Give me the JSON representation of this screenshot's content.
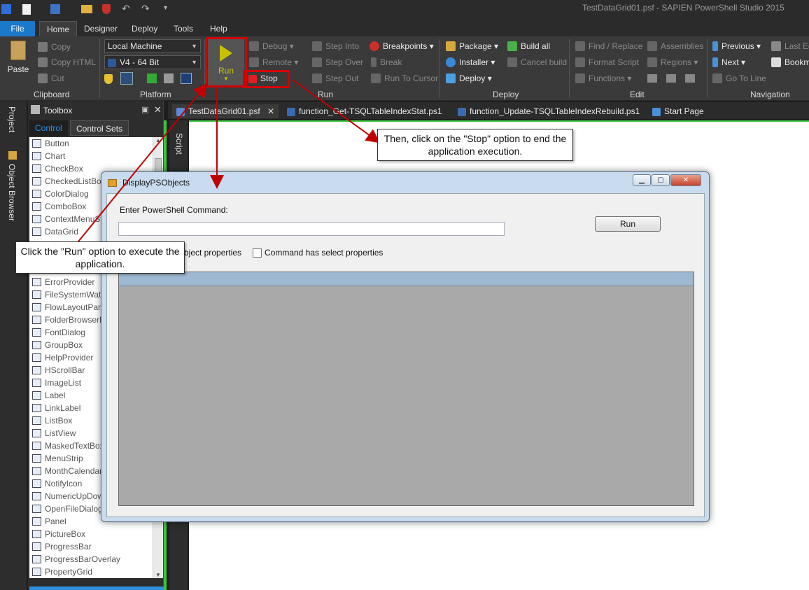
{
  "window_title": "TestDataGrid01.psf - SAPIEN PowerShell Studio 2015",
  "menu": {
    "tabs": [
      "File",
      "Home",
      "Designer",
      "Deploy",
      "Tools",
      "Help"
    ]
  },
  "ribbon": {
    "clipboard": {
      "paste": "Paste",
      "copy": "Copy",
      "copy_html": "Copy HTML",
      "cut": "Cut",
      "label": "Clipboard"
    },
    "platform": {
      "machine": "Local Machine",
      "version": "V4  -  64 Bit",
      "label": "Platform"
    },
    "run": {
      "run": "Run",
      "debug": "Debug",
      "remote": "Remote",
      "stop": "Stop",
      "step_into": "Step Into",
      "step_over": "Step Over",
      "step_out": "Step Out",
      "breakpoints": "Breakpoints",
      "break": "Break",
      "run_to_cursor": "Run To Cursor",
      "label": "Run"
    },
    "deploy": {
      "package": "Package",
      "installer": "Installer",
      "deploy": "Deploy",
      "build_all": "Build all",
      "cancel_build": "Cancel build",
      "label": "Deploy"
    },
    "edit": {
      "find_replace": "Find / Replace",
      "format_script": "Format Script",
      "functions": "Functions",
      "assemblies": "Assemblies",
      "regions": "Regions",
      "label": "Edit"
    },
    "navigation": {
      "previous": "Previous",
      "next": "Next",
      "go_to_line": "Go To Line",
      "last_edit": "Last Ed",
      "bookmark": "Bookma",
      "label": "Navigation"
    }
  },
  "dock": {
    "project": "Project",
    "object_browser": "Object Browser",
    "script": "Script"
  },
  "toolbox": {
    "title": "Toolbox",
    "tab_control": "Control",
    "tab_control_sets": "Control Sets",
    "items": [
      "Button",
      "Chart",
      "CheckBox",
      "CheckedListBox",
      "ColorDialog",
      "ComboBox",
      "ContextMenuStrip",
      "DataGrid",
      "",
      "",
      "",
      "ErrorProvider",
      "FileSystemWatcher",
      "FlowLayoutPanel",
      "FolderBrowserDialog",
      "FontDialog",
      "GroupBox",
      "HelpProvider",
      "HScrollBar",
      "ImageList",
      "Label",
      "LinkLabel",
      "ListBox",
      "ListView",
      "MaskedTextBox",
      "MenuStrip",
      "MonthCalendar",
      "NotifyIcon",
      "NumericUpDown",
      "OpenFileDialog",
      "Panel",
      "PictureBox",
      "ProgressBar",
      "ProgressBarOverlay",
      "PropertyGrid"
    ]
  },
  "doc_tabs": [
    "TestDataGrid01.psf",
    "function_Get-TSQLTableIndexStat.ps1",
    "function_Update-TSQLTableIndexRebuild.ps1",
    "Start Page"
  ],
  "form": {
    "title": "DisplayPSObjects",
    "label_command": "Enter PowerShell Command:",
    "command_value": "",
    "run_button": "Run",
    "checkbox1": "bject properties",
    "checkbox2": "Command has select properties"
  },
  "callouts": {
    "run": "Click the \"Run\" option to execute the application.",
    "stop": "Then, click on the \"Stop\" option to end the application execution."
  },
  "colors": {
    "accent": "#1c78c9",
    "highlight": "#d40000",
    "editor_border": "#3ec43e"
  }
}
